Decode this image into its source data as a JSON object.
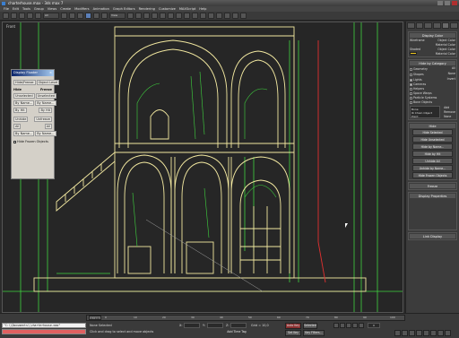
{
  "window": {
    "title": "charterhouse.max - 3ds max 7"
  },
  "menu": [
    "File",
    "Edit",
    "Tools",
    "Group",
    "Views",
    "Create",
    "Modifiers",
    "Animation",
    "Graph Editors",
    "Rendering",
    "Customize",
    "MAXScript",
    "Help"
  ],
  "toolbar": {
    "selection_filter": "All",
    "view_dropdown": "View"
  },
  "viewport": {
    "label": "Front"
  },
  "dialog": {
    "title": "Display Floater",
    "tabs": [
      "Hide/Freeze",
      "Object Level"
    ],
    "col_headers": [
      "Hide",
      "Freeze"
    ],
    "rows": [
      [
        "Unselected",
        "Unselected"
      ],
      [
        "By Name...",
        "By Name..."
      ],
      [
        "By Hit",
        "By Hit"
      ],
      [
        "Unhide",
        "Unfreeze"
      ],
      [
        "All",
        "All"
      ],
      [
        "By Name...",
        "By Name..."
      ]
    ],
    "checkbox_label": "Hide Frozen Objects"
  },
  "command_panel": {
    "display_color": {
      "title": "Display Color",
      "wireframe_label": "Wireframe",
      "shaded_label": "Shaded",
      "object_color": "Object Color",
      "material_color": "Material Color"
    },
    "hide_by_category": {
      "title": "Hide by Category",
      "items": [
        "Geometry",
        "Shapes",
        "Lights",
        "Cameras",
        "Helpers",
        "Space Warps",
        "Particle Systems",
        "Bone Objects"
      ],
      "buttons": [
        "All",
        "None",
        "Invert"
      ],
      "extra": [
        "Bone",
        "IK Chain Object",
        "Point"
      ],
      "side_buttons": [
        "Add",
        "Remove",
        "None"
      ]
    },
    "hide": {
      "title": "Hide",
      "buttons": [
        "Hide Selected",
        "Hide Unselected",
        "Hide by Name...",
        "Hide by Hit",
        "Unhide All",
        "Unhide by Name...",
        "Hide Frozen Objects"
      ]
    },
    "freeze_title": "Freeze",
    "display_properties_title": "Display Properties",
    "link_display_title": "Link Display"
  },
  "timeline": {
    "slider": "0 / 100",
    "ticks": [
      "0",
      "10",
      "20",
      "30",
      "40",
      "50",
      "60",
      "70",
      "80",
      "90",
      "100"
    ]
  },
  "status": {
    "maxscript": "\"C:\\\\Documents\\\\charterhouse.max\"",
    "line1": "None Selected",
    "line2": "Click and drag to select and move objects",
    "x_label": "X:",
    "y_label": "Y:",
    "z_label": "Z:",
    "grid": "Grid = 10,0",
    "auto_key": "Auto Key",
    "set_key": "Set Key",
    "selected": "Selected",
    "key_filters": "Key Filters...",
    "add_time_tag": "Add Time Tag",
    "frame": "0"
  },
  "colors": {
    "wire_yellow": "#f2e8a0",
    "wire_green": "#3fd43f",
    "wire_red": "#e03030",
    "accent": "#5b7fb8"
  }
}
